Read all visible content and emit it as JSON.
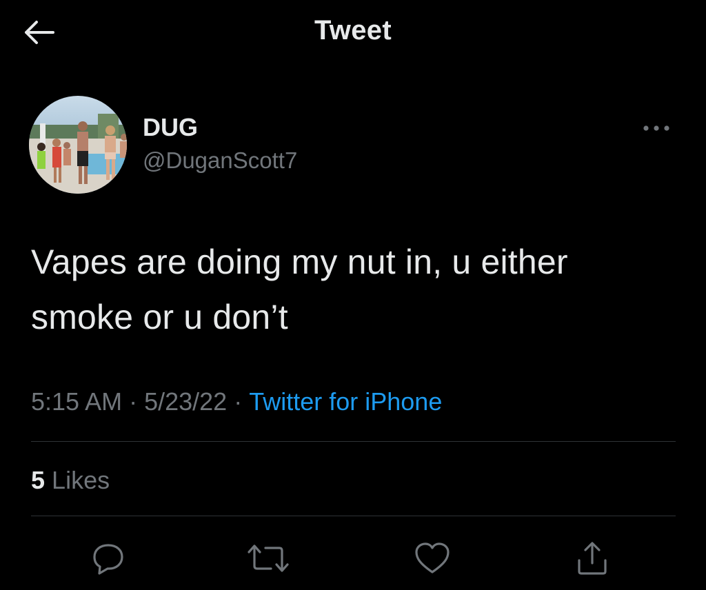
{
  "header": {
    "title": "Tweet",
    "back_icon": "arrow-left-icon"
  },
  "author": {
    "display_name": "DUG",
    "handle": "@DuganScott7",
    "avatar_description_icon": "avatar-photo"
  },
  "tweet": {
    "text_line1": "Vapes are doing my nut in, u either",
    "text_line2": "smoke or u don’t",
    "time": "5:15 AM",
    "separator": "·",
    "date": "5/23/22",
    "source": "Twitter for iPhone"
  },
  "stats": {
    "likes_count": "5",
    "likes_label": "Likes"
  },
  "actions": {
    "reply_icon": "reply-icon",
    "retweet_icon": "retweet-icon",
    "like_icon": "heart-icon",
    "share_icon": "share-icon"
  },
  "colors": {
    "background": "#000000",
    "primary_text": "#e7e9ea",
    "secondary_text": "#71767b",
    "link": "#1d9bf0",
    "divider": "#2f3336"
  }
}
